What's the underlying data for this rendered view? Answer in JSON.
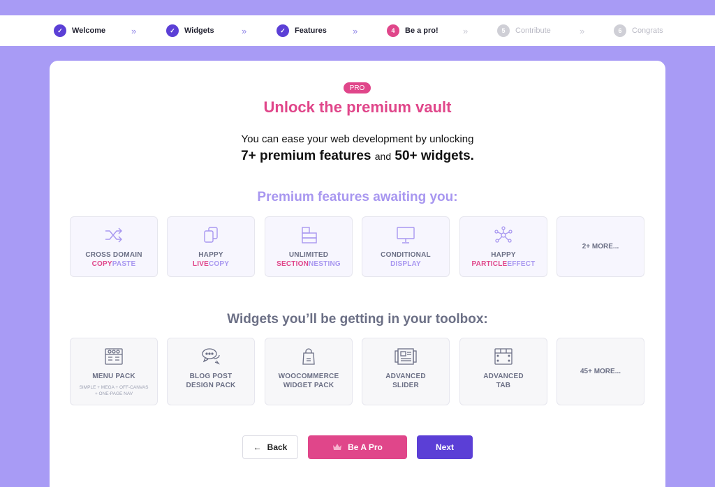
{
  "steps": [
    {
      "label": "Welcome",
      "marker": "✓",
      "state": "done"
    },
    {
      "label": "Widgets",
      "marker": "✓",
      "state": "done"
    },
    {
      "label": "Features",
      "marker": "✓",
      "state": "done"
    },
    {
      "label": "Be a pro!",
      "marker": "4",
      "state": "current"
    },
    {
      "label": "Contribute",
      "marker": "5",
      "state": "future"
    },
    {
      "label": "Congrats",
      "marker": "6",
      "state": "future"
    }
  ],
  "separator": "»",
  "badge": "PRO",
  "title": "Unlock the premium vault",
  "intro": {
    "line1": "You can ease your web development by unlocking",
    "features_count": "7+ premium features",
    "and": "and",
    "widgets_count": "50+ widgets."
  },
  "features_title": "Premium features awaiting you:",
  "features": [
    {
      "l1": "CROSS DOMAIN",
      "l2a": "COPY",
      "l2b": "PASTE",
      "icon": "shuffle-icon"
    },
    {
      "l1": "HAPPY",
      "l2a": "LIVE",
      "l2b": "COPY",
      "icon": "copy-icon"
    },
    {
      "l1": "UNLIMITED",
      "l2a": "SECTION",
      "l2b": "NESTING",
      "icon": "nesting-icon"
    },
    {
      "l1a": "CONDITIONAL",
      "l2b": "DISPLAY",
      "icon": "monitor-icon"
    },
    {
      "l1": "HAPPY",
      "l2a": "PARTICLE",
      "l2b": "EFFECT",
      "icon": "particle-icon"
    },
    {
      "more": "2+ MORE..."
    }
  ],
  "widgets_title": "Widgets you’ll be getting in your toolbox:",
  "widgets": [
    {
      "l1": "MENU PACK",
      "sub": "SIMPLE + MEGA + OFF-CANVAS + ONE-PAGE NAV",
      "icon": "menu-pack-icon"
    },
    {
      "l1": "BLOG POST",
      "l2": "DESIGN PACK",
      "icon": "chat-bubbles-icon"
    },
    {
      "l1": "WOOCOMMERCE",
      "l2": "WIDGET PACK",
      "icon": "shopping-bag-icon"
    },
    {
      "l1": "ADVANCED",
      "l2": "SLIDER",
      "icon": "slider-icon"
    },
    {
      "l1": "ADVANCED",
      "l2": "TAB",
      "icon": "tab-icon"
    },
    {
      "more": "45+ MORE..."
    }
  ],
  "buttons": {
    "back": "Back",
    "back_icon": "←",
    "pro": "Be A Pro",
    "next": "Next"
  },
  "colors": {
    "accent": "#5b3fd6",
    "pink": "#e0468a",
    "lavender": "#a897f0",
    "background": "#a89bf5"
  }
}
